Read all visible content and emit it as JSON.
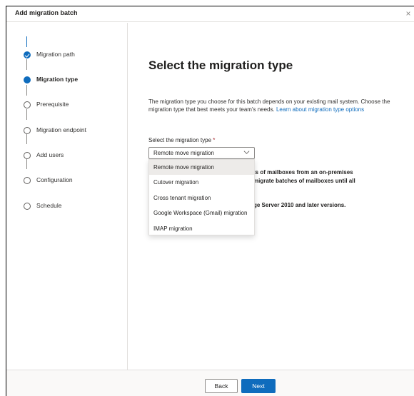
{
  "header": {
    "title": "Add migration batch",
    "close_label": "×"
  },
  "steps": [
    {
      "label": "Migration path",
      "state": "done"
    },
    {
      "label": "Migration type",
      "state": "current"
    },
    {
      "label": "Prerequisite",
      "state": "pending"
    },
    {
      "label": "Migration endpoint",
      "state": "pending"
    },
    {
      "label": "Add users",
      "state": "pending"
    },
    {
      "label": "Configuration",
      "state": "pending"
    },
    {
      "label": "Schedule",
      "state": "pending"
    }
  ],
  "main": {
    "title": "Select the migration type",
    "description": "The migration type you choose for this batch depends on your existing mail system. Choose the migration type that best meets your team's needs. ",
    "learn_link": "Learn about migration type options",
    "field_label": "Select the migration type",
    "required_mark": "*",
    "selected_value": "Remote move migration",
    "occluded_text_1": "ts of mailboxes from an on-premises",
    "occluded_text_2": "migrate batches of mailboxes until all",
    "occluded_text_3": "ge Server 2010 and later versions."
  },
  "dropdown_options": [
    "Remote move migration",
    "Cutover migration",
    "Cross tenant migration",
    "Google Workspace (Gmail) migration",
    "IMAP migration"
  ],
  "footer": {
    "back_label": "Back",
    "next_label": "Next"
  },
  "colors": {
    "accent": "#0f6cbd",
    "required": "#a4262c"
  }
}
